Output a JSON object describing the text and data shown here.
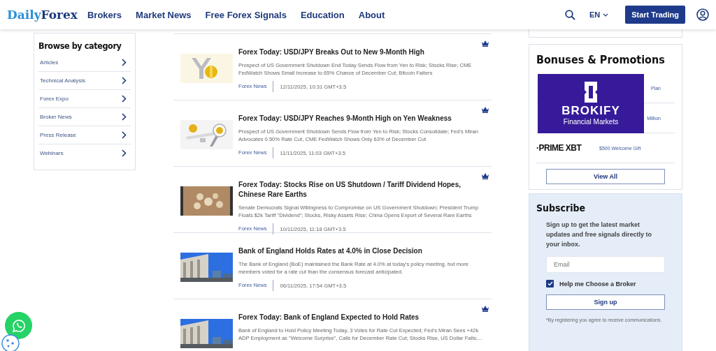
{
  "header": {
    "logo": {
      "part_1": "Daily",
      "part_2": "Forex"
    },
    "nav": [
      {
        "label": "Brokers"
      },
      {
        "label": "Market News"
      },
      {
        "label": "Free Forex Signals"
      },
      {
        "label": "Education"
      },
      {
        "label": "About"
      }
    ],
    "language": "EN",
    "cta": "Start Trading"
  },
  "sidebar": {
    "title": "Browse by category",
    "items": [
      {
        "label": "Articles"
      },
      {
        "label": "Technical Analysis"
      },
      {
        "label": "Forex Expo"
      },
      {
        "label": "Broker News"
      },
      {
        "label": "Press Release"
      },
      {
        "label": "Webinars"
      }
    ]
  },
  "articles": [
    {
      "title": "Forex Today: USD/JPY Breaks Out to New 9-Month High",
      "summary": "Prospect of US Government Shutdown End Today Sends Flow from Yen to Risk; Stocks Rise; CME FedWatch Shows Small Increase to 65% Chance of December Cut; Bitcoin Falters",
      "category": "Forex News",
      "date": "12/11/2025, 10:31 GMT+3.5",
      "premium": true
    },
    {
      "title": "Forex Today: USD/JPY Reaches 9-Month High on Yen Weakness",
      "summary": "Prospect of US Government Shutdown Sends Flow from Yen to Risk; Stocks Consolidate; Fed's Miran Advocates 0.50% Rate Cut, CME FedWatch Shows Only 63% of December Cut",
      "category": "Forex News",
      "date": "11/11/2025, 11:03 GMT+3.5",
      "premium": true
    },
    {
      "title": "Forex Today: Stocks Rise on US Shutdown / Tariff Dividend Hopes, Chinese Rare Earths",
      "summary": "Senate Democrats Signal Willingness to Compromise on US Government Shutdown; President Trump Floats $2k Tariff \"Dividend\"; Stocks, Risky Assets Rise; China Opens Export of Several Rare Earths",
      "category": "Forex News",
      "date": "10/11/2025, 11:18 GMT+3.5",
      "premium": true
    },
    {
      "title": "Bank of England Holds Rates at 4.0% in Close Decision",
      "summary": "The Bank of England (BoE) maintained the Bank Rate at 4.0% at today's policy meeting, but more members voted for a rate cut than the consensus forecast anticipated.",
      "category": "Forex News",
      "date": "06/11/2025, 17:54 GMT+3.5",
      "premium": false
    },
    {
      "title": "Forex Today: Bank of England Expected to Hold Rates",
      "summary": "Bank of England to Hold Policy Meeting Today, 3 Votes for Rate Cut Expected; Fed's Miran Sees +42k ADP Employment as \"Welcome Surprise\", Calls for December Rate Cut; Stocks Rise, US Dollar Falls;...",
      "premium": true
    }
  ],
  "promotions": {
    "title": "Bonuses & Promotions",
    "items": [
      {
        "offer": "Plan"
      },
      {
        "offer": "Million"
      },
      {
        "broker": "·PRIME XBT",
        "offer": "$500 Welcome Gift"
      }
    ],
    "overlay": {
      "brand": "BROKIFY",
      "tagline": "Financial Markets"
    },
    "button": "View All"
  },
  "subscribe": {
    "title": "Subscribe",
    "text": "Sign up to get the latest market updates and free signals directly to your inbox.",
    "email": {
      "placeholder": "Email"
    },
    "checkbox": {
      "label": "Help me Choose a Broker",
      "checked": true
    },
    "button": "Sign up",
    "note": "*By registering you agree to receive communications."
  }
}
